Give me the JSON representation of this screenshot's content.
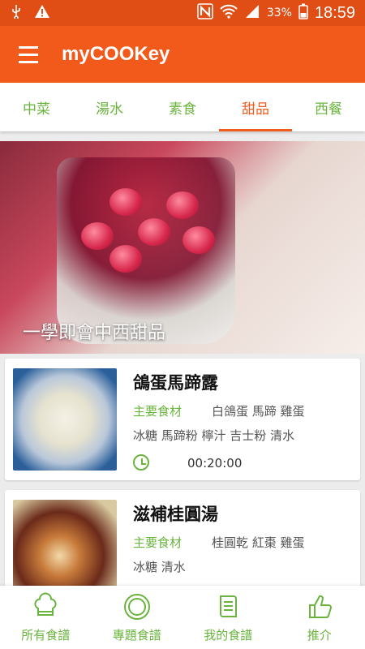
{
  "status_bar": {
    "battery": "33%",
    "time": "18:59",
    "icons": [
      "usb-icon",
      "warning-icon",
      "nfc-icon",
      "wifi-icon",
      "signal-icon",
      "battery-icon"
    ]
  },
  "app_bar": {
    "title": "myCOOKey"
  },
  "tabs": [
    {
      "label": "中菜",
      "active": false
    },
    {
      "label": "湯水",
      "active": false
    },
    {
      "label": "素食",
      "active": false
    },
    {
      "label": "甜品",
      "active": true
    },
    {
      "label": "西餐",
      "active": false
    }
  ],
  "hero": {
    "caption": "一學即會中西甜品"
  },
  "recipes": [
    {
      "title": "鴿蛋馬蹄露",
      "ingredients_label": "主要食材",
      "ingredients_line1": "白鴿蛋 馬蹄 雞蛋",
      "ingredients_line2": "冰糖 馬蹄粉 檸汁 吉士粉 清水",
      "time": "00:20:00"
    },
    {
      "title": "滋補桂圓湯",
      "ingredients_label": "主要食材",
      "ingredients_line1": "桂圓乾 紅棗 雞蛋",
      "ingredients_line2": "冰糖 清水"
    }
  ],
  "bottom_nav": [
    {
      "label": "所有食譜",
      "icon": "chef-hat-icon"
    },
    {
      "label": "專題食譜",
      "icon": "plate-icon"
    },
    {
      "label": "我的食譜",
      "icon": "scroll-icon"
    },
    {
      "label": "推介",
      "icon": "thumbs-up-icon"
    }
  ],
  "colors": {
    "accent": "#f25a1b",
    "status": "#e04e16",
    "green": "#6ab43e"
  }
}
